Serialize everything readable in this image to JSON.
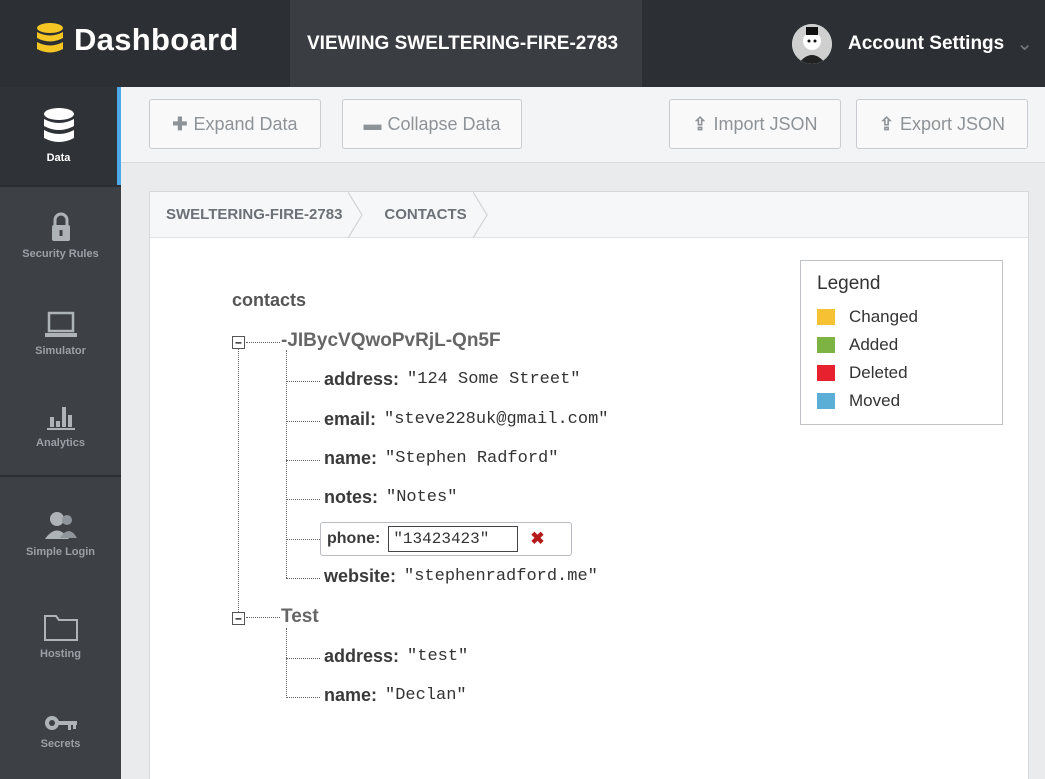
{
  "header": {
    "brand": "Dashboard",
    "viewing": "VIEWING SWELTERING-FIRE-2783",
    "account_label": "Account Settings"
  },
  "sidebar": {
    "items": [
      {
        "label": "Data",
        "icon": "database-icon",
        "active": true
      },
      {
        "label": "Security Rules",
        "icon": "lock-icon"
      },
      {
        "label": "Simulator",
        "icon": "laptop-icon"
      },
      {
        "label": "Analytics",
        "icon": "bar-chart-icon"
      },
      {
        "label": "Simple Login",
        "icon": "users-icon"
      },
      {
        "label": "Hosting",
        "icon": "folder-icon"
      },
      {
        "label": "Secrets",
        "icon": "key-icon"
      }
    ]
  },
  "toolbar": {
    "expand": "Expand Data",
    "collapse": "Collapse Data",
    "import": "Import JSON",
    "export": "Export JSON"
  },
  "breadcrumb": [
    "SWELTERING-FIRE-2783",
    "CONTACTS"
  ],
  "tree": {
    "root": "contacts",
    "records": [
      {
        "key": "-JIBycVQwoPvRjL-Qn5F",
        "fields": [
          {
            "key": "address:",
            "value": "\"124 Some Street\""
          },
          {
            "key": "email:",
            "value": "\"steve228uk@gmail.com\""
          },
          {
            "key": "name:",
            "value": "\"Stephen Radford\""
          },
          {
            "key": "notes:",
            "value": "\"Notes\""
          },
          {
            "key": "phone:",
            "value": "\"13423423\"",
            "editing": true
          },
          {
            "key": "website:",
            "value": "\"stephenradford.me\""
          }
        ]
      },
      {
        "key": "Test",
        "fields": [
          {
            "key": "address:",
            "value": "\"test\""
          },
          {
            "key": "name:",
            "value": "\"Declan\""
          }
        ]
      }
    ]
  },
  "legend": {
    "title": "Legend",
    "items": [
      {
        "label": "Changed",
        "color": "#f6c233"
      },
      {
        "label": "Added",
        "color": "#7cb342"
      },
      {
        "label": "Deleted",
        "color": "#e8212e"
      },
      {
        "label": "Moved",
        "color": "#5bafd6"
      }
    ]
  },
  "colors": {
    "accent": "#4da8e8",
    "brand_icon": "#f5c623",
    "delete_x": "#b51b1b"
  }
}
